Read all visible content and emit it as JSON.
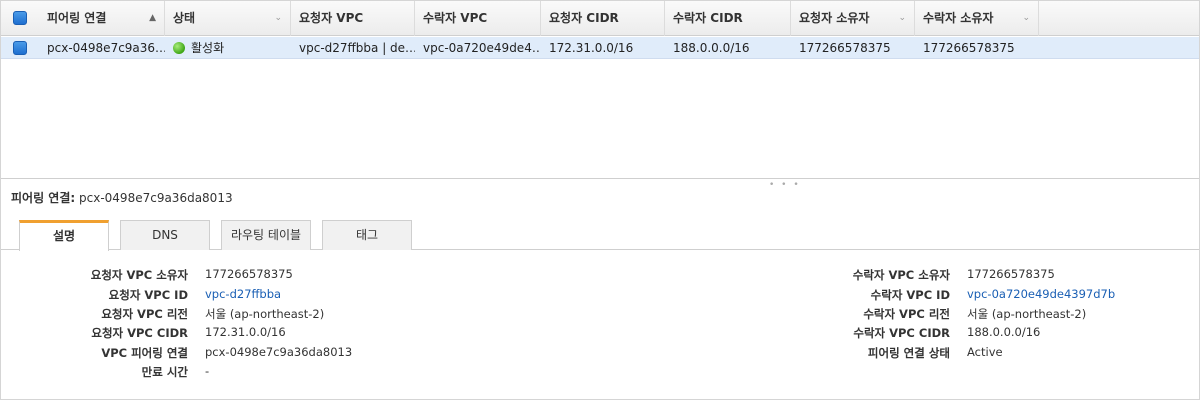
{
  "table": {
    "columns": [
      "피어링 연결",
      "상태",
      "요청자 VPC",
      "수락자 VPC",
      "요청자 CIDR",
      "수락자 CIDR",
      "요청자 소유자",
      "수락자 소유자"
    ],
    "row": {
      "peering_connection": "pcx-0498e7c9a36…",
      "status": "활성화",
      "requester_vpc": "vpc-d27ffbba | de…",
      "accepter_vpc": "vpc-0a720e49de4…",
      "requester_cidr": "172.31.0.0/16",
      "accepter_cidr": "188.0.0.0/16",
      "requester_owner": "177266578375",
      "accepter_owner": "177266578375"
    }
  },
  "detail": {
    "title_label": "피어링 연결:",
    "title_value": "pcx-0498e7c9a36da8013",
    "tabs": [
      "설명",
      "DNS",
      "라우팅 테이블",
      "태그"
    ],
    "left": [
      {
        "label": "요청자 VPC 소유자",
        "value": "177266578375"
      },
      {
        "label": "요청자 VPC ID",
        "value": "vpc-d27ffbba"
      },
      {
        "label": "요청자 VPC 리전",
        "value": "서울 (ap-northeast-2)"
      },
      {
        "label": "요청자 VPC CIDR",
        "value": "172.31.0.0/16"
      },
      {
        "label": "VPC 피어링 연결",
        "value": "pcx-0498e7c9a36da8013"
      },
      {
        "label": "만료 시간",
        "value": "-"
      }
    ],
    "right": [
      {
        "label": "수락자 VPC 소유자",
        "value": "177266578375"
      },
      {
        "label": "수락자 VPC ID",
        "value": "vpc-0a720e49de4397d7b"
      },
      {
        "label": "수락자 VPC 리전",
        "value": "서울 (ap-northeast-2)"
      },
      {
        "label": "수락자 VPC CIDR",
        "value": "188.0.0.0/16"
      },
      {
        "label": "피어링 연결 상태",
        "value": "Active"
      }
    ]
  },
  "colors": {
    "accent_tab": "#f0a030",
    "link": "#1a5fb4",
    "row_selected": "#e0ecfa",
    "status_active": "#3ea616"
  }
}
